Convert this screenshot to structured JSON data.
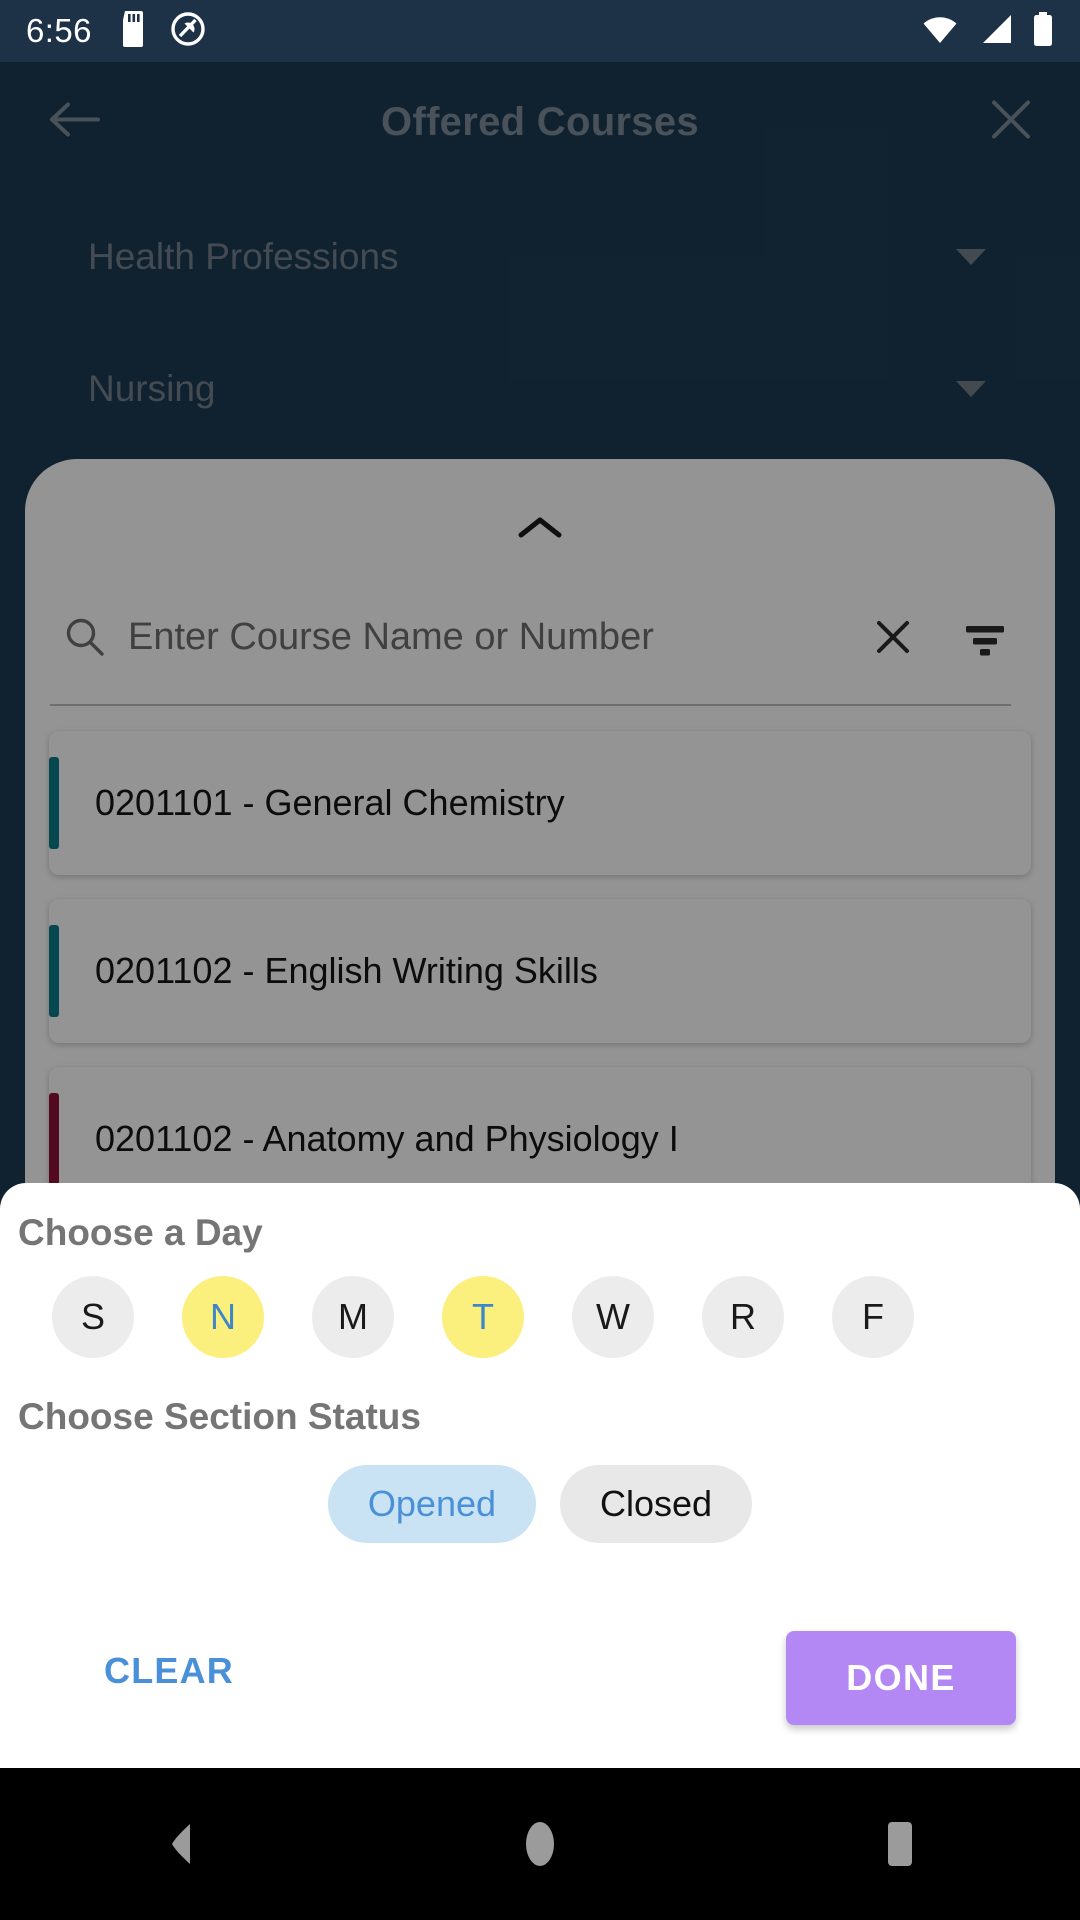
{
  "status_bar": {
    "clock": "6:56",
    "icons": [
      "sd-card-icon",
      "do-not-disturb-icon",
      "wifi-icon",
      "cellular-signal-icon",
      "battery-icon"
    ]
  },
  "app_bar": {
    "title": "Offered Courses",
    "back_icon": "arrow-left-icon",
    "close_icon": "close-x-icon"
  },
  "filters": {
    "faculty": "Health Professions",
    "department": "Nursing"
  },
  "search": {
    "placeholder": "Enter Course Name or Number",
    "value": "",
    "search_icon": "search-icon",
    "clear_icon": "close-x-icon",
    "filter_icon": "filter-icon"
  },
  "courses": [
    {
      "title": "0201101 - General Chemistry",
      "accent": "#0D7A8A"
    },
    {
      "title": "0201102 - English Writing Skills",
      "accent": "#0D7A8A"
    },
    {
      "title": "0201102 - Anatomy and Physiology I",
      "accent": "#8C1238"
    }
  ],
  "bottom_sheet": {
    "day_heading": "Choose a Day",
    "days": [
      {
        "label": "S",
        "selected": false
      },
      {
        "label": "N",
        "selected": true
      },
      {
        "label": "M",
        "selected": false
      },
      {
        "label": "T",
        "selected": true
      },
      {
        "label": "W",
        "selected": false
      },
      {
        "label": "R",
        "selected": false
      },
      {
        "label": "F",
        "selected": false
      }
    ],
    "status_heading": "Choose Section Status",
    "statuses": [
      {
        "label": "Opened",
        "selected": true
      },
      {
        "label": "Closed",
        "selected": false
      }
    ],
    "clear_label": "CLEAR",
    "done_label": "DONE"
  },
  "nav_bar": {
    "back": "nav-back-icon",
    "home": "nav-home-icon",
    "recents": "nav-recents-icon"
  },
  "colors": {
    "app_background": "#1D3A54",
    "status_bar": "#1D3247",
    "selected_day_bg": "#FBEF7E",
    "selected_day_text": "#3E88C8",
    "selected_status_bg": "#C9E3F5",
    "selected_status_text": "#4A90D9",
    "done_button": "#B388F5",
    "clear_text": "#4A90D9"
  }
}
